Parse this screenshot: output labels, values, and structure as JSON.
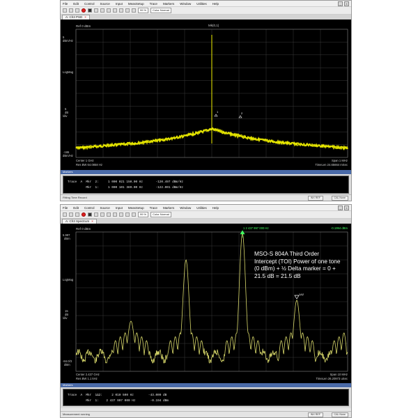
{
  "menu": [
    "File",
    "Edit",
    "Control",
    "Source",
    "Input",
    "MeasSetup",
    "Trace",
    "Markers",
    "Window",
    "Utilities",
    "Help"
  ],
  "toolbar": {
    "zoom": "99 %",
    "color_mode": "Color Normal"
  },
  "window1": {
    "tab": "A: Ch3 PSD",
    "ref_level": "Ref 0 dBm",
    "center_marker": "Mk(0,1)",
    "y_ticks": {
      "top": "5\ndBm/Hz",
      "mid": "LogMag",
      "lower": "5\ndB\n/div",
      "bottom": "-165\ndBm/Hz"
    },
    "bottom_left": [
      "Center 1 GHz",
      "Res BW 64.0858 Hz"
    ],
    "bottom_right": [
      "Span 1 MHz",
      "TimeLen 24.65664 mSec"
    ],
    "marker_labels": [
      "1",
      "2"
    ],
    "markers_title": "Markers",
    "marker_rows": [
      "Trace  A  Mkr  2:     1 000 021 150.00 Hz       -120.497 dBm/Hz",
      "          Mkr  1:     1 000 101 389.00 Hz       -122.001 dBm/Hz"
    ],
    "status_left": "Fitting Time Record",
    "status_boxes": [
      "INX REF",
      "CAL None"
    ]
  },
  "window2": {
    "tab": "A: Ch3 Spectrum",
    "ref_level": "Ref 0 dBm",
    "top_readout": "1  2 437 997 000 Hz",
    "top_right": "-0.1994 dBm",
    "y_ticks": {
      "top": "5.997\ndBm",
      "mid": "LogMag",
      "lower": "15\ndB\n/div",
      "bottom": "-84.0/3\ndBm"
    },
    "bottom_left": [
      "Center 2.437 GHz",
      "Res BW 1.1 kHz"
    ],
    "bottom_right": [
      "Span 10 MHz",
      "TimeLen 26.20973 uSec"
    ],
    "marker_labels": [
      "1",
      "1Δ2"
    ],
    "annotation": "MSO-S 804A Third Order Intercept (TOI) Power of one tone (0 dBm) + ½ Delta marker = 0 + 21.5 dB = 21.5 dB",
    "markers_title": "Markers",
    "marker_rows": [
      "Trace  A  Mkr  1Δ2:     2 010 500 Hz        -43.009 dB",
      "          Mkr  1:    2 437 997 000 Hz        -0.194 dBm"
    ],
    "status_left": "Measurement running",
    "status_boxes": [
      "INX REF",
      "CAL None"
    ]
  },
  "colors": {
    "trace": "#f0f000",
    "grid": "#3a3a3a",
    "marker_green": "#40ff60"
  }
}
